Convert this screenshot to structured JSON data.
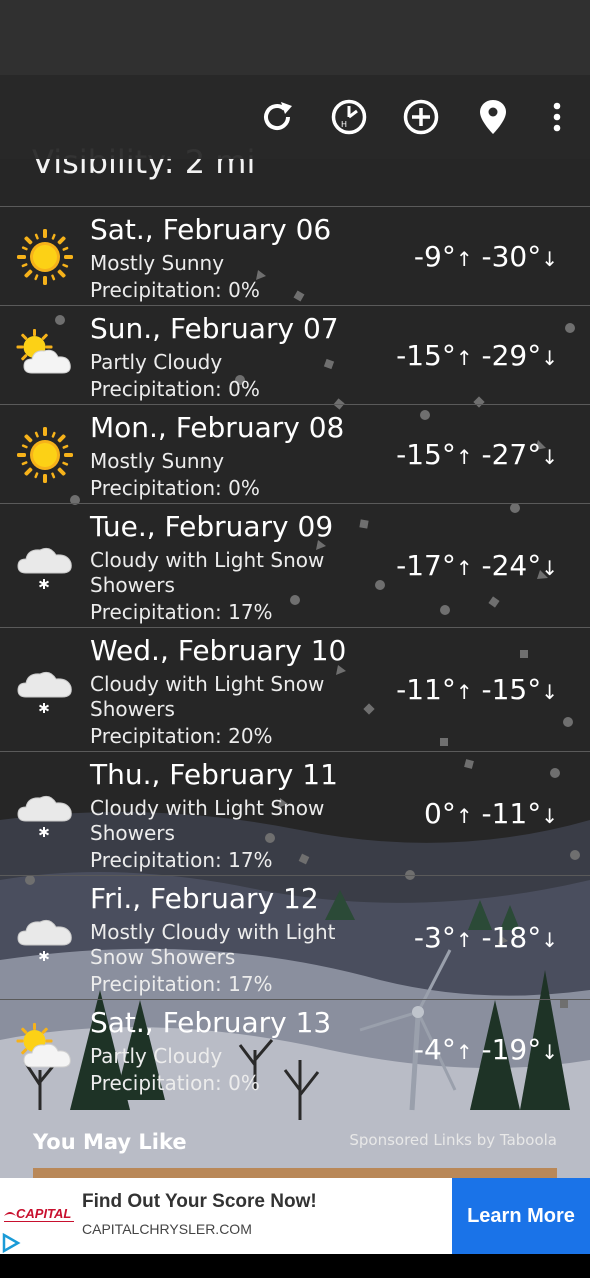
{
  "partial_line": "Visibility: 2 mi",
  "toolbar": {
    "icons": [
      "refresh-icon",
      "history-clock-icon",
      "add-location-icon",
      "location-pin-icon",
      "more-vert-icon"
    ]
  },
  "days": [
    {
      "date": "Sat., February 06",
      "condition": "Mostly Sunny",
      "precip": "Precipitation: 0%",
      "high": "-9°",
      "low": "-30°",
      "icon": "sun-icon",
      "height": 99
    },
    {
      "date": "Sun., February 07",
      "condition": "Partly Cloudy",
      "precip": "Precipitation: 0%",
      "high": "-15°",
      "low": "-29°",
      "icon": "partly-cloudy-icon",
      "height": 99
    },
    {
      "date": "Mon., February 08",
      "condition": "Mostly Sunny",
      "precip": "Precipitation: 0%",
      "high": "-15°",
      "low": "-27°",
      "icon": "sun-icon",
      "height": 99
    },
    {
      "date": "Tue., February 09",
      "condition": "Cloudy with Light Snow Showers",
      "precip": "Precipitation: 17%",
      "high": "-17°",
      "low": "-24°",
      "icon": "snow-cloud-icon",
      "height": 124
    },
    {
      "date": "Wed., February 10",
      "condition": "Cloudy with Light Snow Showers",
      "precip": "Precipitation: 20%",
      "high": "-11°",
      "low": "-15°",
      "icon": "snow-cloud-icon",
      "height": 124
    },
    {
      "date": "Thu., February 11",
      "condition": "Cloudy with Light Snow Showers",
      "precip": "Precipitation: 17%",
      "high": "0°",
      "low": "-11°",
      "icon": "snow-cloud-icon",
      "height": 124
    },
    {
      "date": "Fri., February 12",
      "condition": "Mostly Cloudy with Light Snow Showers",
      "precip": "Precipitation: 17%",
      "high": "-3°",
      "low": "-18°",
      "icon": "snow-cloud-icon",
      "height": 124
    },
    {
      "date": "Sat., February 13",
      "condition": "Partly Cloudy",
      "precip": "Precipitation: 0%",
      "high": "-4°",
      "low": "-19°",
      "icon": "partly-cloudy-icon",
      "height": 99
    }
  ],
  "recommend": {
    "heading": "You May Like",
    "sponsored": "Sponsored Links by Taboola"
  },
  "ad": {
    "title": "Find Out Your Score Now!",
    "url": "CAPITALCHRYSLER.COM",
    "button": "Learn More",
    "logo_text": "CAPITAL",
    "accent": "#1a73e8"
  }
}
